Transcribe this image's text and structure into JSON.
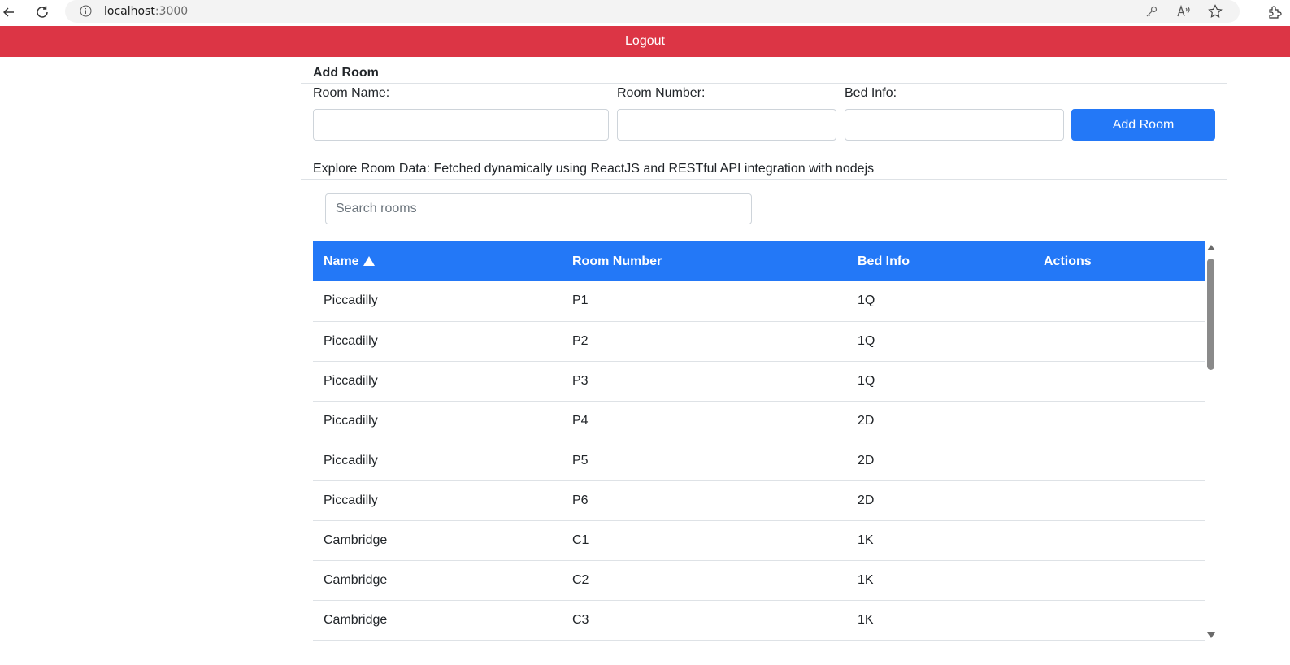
{
  "browser": {
    "url_host": "localhost",
    "url_port": ":3000",
    "icons": [
      "back-icon",
      "refresh-icon",
      "info-icon",
      "key-icon",
      "read-aloud-icon",
      "favorite-star-icon",
      "extensions-icon"
    ]
  },
  "header": {
    "logout_label": "Logout"
  },
  "form": {
    "title": "Add Room",
    "room_name_label": "Room Name:",
    "room_number_label": "Room Number:",
    "bed_info_label": "Bed Info:",
    "room_name_value": "",
    "room_number_value": "",
    "bed_info_value": "",
    "add_button_label": "Add Room"
  },
  "explore_text": "Explore Room Data: Fetched dynamically using ReactJS and RESTful API integration with nodejs",
  "search": {
    "placeholder": "Search rooms",
    "value": ""
  },
  "table": {
    "columns": [
      "Name",
      "Room Number",
      "Bed Info",
      "Actions"
    ],
    "sort_column": "Name",
    "sort_direction": "ascending",
    "rows": [
      {
        "name": "Piccadilly",
        "room_number": "P1",
        "bed_info": "1Q"
      },
      {
        "name": "Piccadilly",
        "room_number": "P2",
        "bed_info": "1Q"
      },
      {
        "name": "Piccadilly",
        "room_number": "P3",
        "bed_info": "1Q"
      },
      {
        "name": "Piccadilly",
        "room_number": "P4",
        "bed_info": "2D"
      },
      {
        "name": "Piccadilly",
        "room_number": "P5",
        "bed_info": "2D"
      },
      {
        "name": "Piccadilly",
        "room_number": "P6",
        "bed_info": "2D"
      },
      {
        "name": "Cambridge",
        "room_number": "C1",
        "bed_info": "1K"
      },
      {
        "name": "Cambridge",
        "room_number": "C2",
        "bed_info": "1K"
      },
      {
        "name": "Cambridge",
        "room_number": "C3",
        "bed_info": "1K"
      }
    ]
  },
  "colors": {
    "logout_bar": "#dc3545",
    "primary": "#2378f7"
  }
}
